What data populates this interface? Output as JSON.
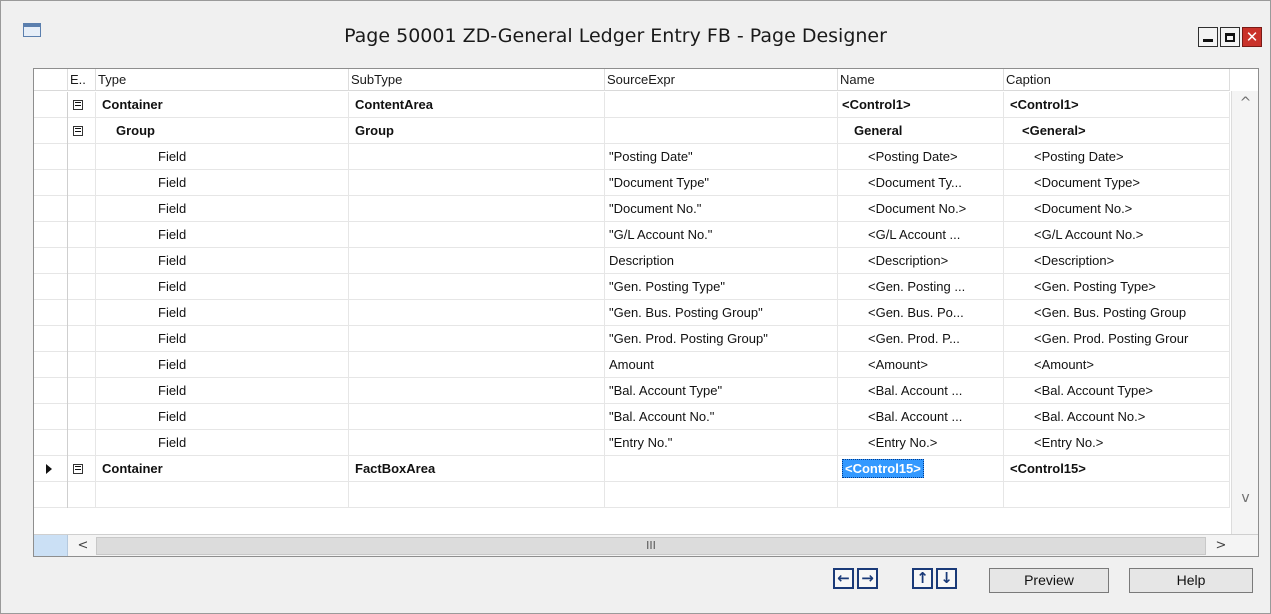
{
  "window": {
    "title": "Page 50001 ZD-General Ledger Entry FB - Page Designer",
    "icon": "window-icon",
    "controls": {
      "minimize": "▬",
      "maximize": "□",
      "close": "✕"
    }
  },
  "grid": {
    "columns": {
      "e": "E..",
      "type": "Type",
      "subtype": "SubType",
      "source": "SourceExpr",
      "name": "Name",
      "caption": "Caption"
    },
    "rows": [
      {
        "expand": true,
        "type": "Container",
        "subtype": "ContentArea",
        "source": "",
        "name": "<Control1>",
        "caption": "<Control1>",
        "bold": true
      },
      {
        "expand": true,
        "type": "Group",
        "subtype": "Group",
        "source": "",
        "name": "General",
        "caption": "<General>",
        "bold": true
      },
      {
        "type": "Field",
        "subtype": "",
        "source": "\"Posting Date\"",
        "name": "<Posting Date>",
        "caption": "<Posting Date>"
      },
      {
        "type": "Field",
        "subtype": "",
        "source": "\"Document Type\"",
        "name": "<Document Ty...",
        "caption": "<Document Type>"
      },
      {
        "type": "Field",
        "subtype": "",
        "source": "\"Document No.\"",
        "name": "<Document No.>",
        "caption": "<Document No.>"
      },
      {
        "type": "Field",
        "subtype": "",
        "source": "\"G/L Account No.\"",
        "name": "<G/L Account ...",
        "caption": "<G/L Account No.>"
      },
      {
        "type": "Field",
        "subtype": "",
        "source": "Description",
        "name": "<Description>",
        "caption": "<Description>"
      },
      {
        "type": "Field",
        "subtype": "",
        "source": "\"Gen. Posting Type\"",
        "name": "<Gen. Posting ...",
        "caption": "<Gen. Posting Type>"
      },
      {
        "type": "Field",
        "subtype": "",
        "source": "\"Gen. Bus. Posting Group\"",
        "name": "<Gen. Bus. Po...",
        "caption": "<Gen. Bus. Posting Group"
      },
      {
        "type": "Field",
        "subtype": "",
        "source": "\"Gen. Prod. Posting Group\"",
        "name": "<Gen. Prod. P...",
        "caption": "<Gen. Prod. Posting Grour"
      },
      {
        "type": "Field",
        "subtype": "",
        "source": "Amount",
        "name": "<Amount>",
        "caption": "<Amount>"
      },
      {
        "type": "Field",
        "subtype": "",
        "source": "\"Bal. Account Type\"",
        "name": "<Bal. Account ...",
        "caption": "<Bal. Account Type>"
      },
      {
        "type": "Field",
        "subtype": "",
        "source": "\"Bal. Account No.\"",
        "name": "<Bal. Account ...",
        "caption": "<Bal. Account No.>"
      },
      {
        "type": "Field",
        "subtype": "",
        "source": "\"Entry No.\"",
        "name": "<Entry No.>",
        "caption": "<Entry No.>"
      },
      {
        "expand": true,
        "selected": true,
        "type": "Container",
        "subtype": "FactBoxArea",
        "source": "",
        "name": "<Control15>",
        "caption": "<Control15>",
        "bold": true
      },
      {
        "type": "",
        "subtype": "",
        "source": "",
        "name": "",
        "caption": ""
      }
    ]
  },
  "scroll": {
    "up": "^",
    "down": "v",
    "left": "<",
    "right": ">",
    "thumb": "III"
  },
  "buttons": {
    "move_left": "←",
    "move_right": "→",
    "move_up": "↑",
    "move_down": "↓",
    "preview": "Preview",
    "help": "Help"
  }
}
